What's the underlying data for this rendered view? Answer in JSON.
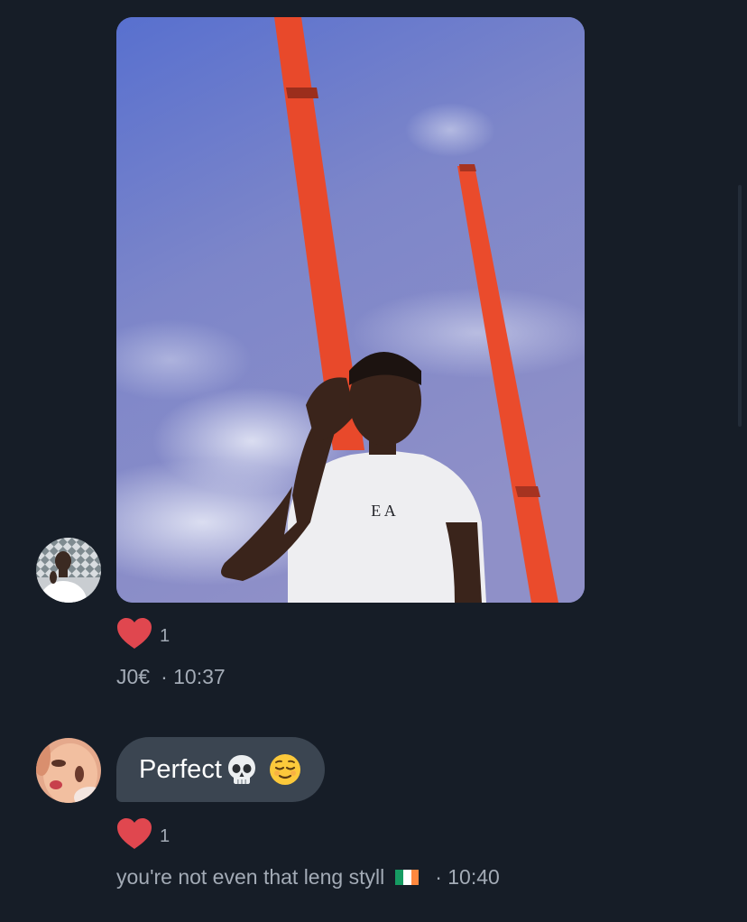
{
  "messages": [
    {
      "sender": "J0€",
      "type": "photo",
      "photo": {
        "shirt_text": "E A"
      },
      "reaction": {
        "icon": "heart-icon",
        "count": "1"
      },
      "time": "· 10:37"
    },
    {
      "sender": "you're not even that leng styll",
      "sender_flag": "ireland-flag-icon",
      "type": "text",
      "text": "Perfect",
      "emojis": [
        "skull-emoji",
        "relieved-face-emoji"
      ],
      "reaction": {
        "icon": "heart-icon",
        "count": "1"
      },
      "time": "· 10:40"
    }
  ],
  "colors": {
    "background": "#161d27",
    "bubble": "#3b4551",
    "meta_text": "#a3abb6",
    "heart": "#e0474f",
    "pole": "#e84a2c"
  }
}
